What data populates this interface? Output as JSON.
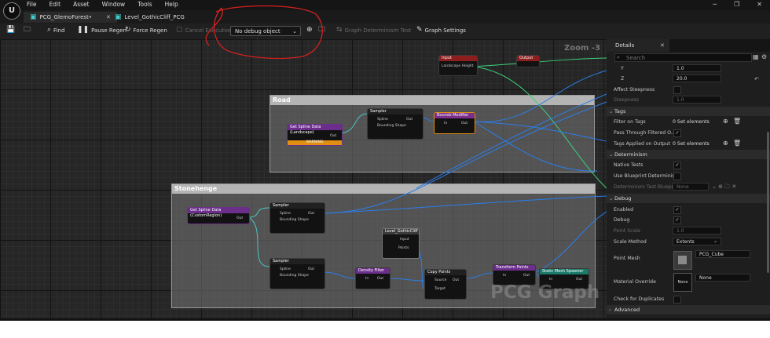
{
  "menu": {
    "logo": "U",
    "items": [
      "File",
      "Edit",
      "Asset",
      "Window",
      "Tools",
      "Help"
    ]
  },
  "tabs": [
    {
      "label": "PCG_GlemoForest•",
      "active": true
    },
    {
      "label": "Level_GothicCliff_PCG",
      "active": false
    }
  ],
  "toolbar": {
    "find": "Find",
    "pause_regen": "Pause Regen",
    "force_regen": "Force Regen",
    "cancel_execution": "Cancel Execution",
    "debug_selector": "No debug object selected",
    "graph_determinism": "Graph Determinism Test",
    "graph_settings": "Graph Settings"
  },
  "graph": {
    "zoom": "Zoom -3",
    "watermark": "PCG Graph",
    "comments": {
      "road": "Road",
      "stonehenge": "Stonehenge"
    },
    "nodes": {
      "input": {
        "title": "Input",
        "pin": "Landscape Height"
      },
      "output": {
        "title": "Output"
      },
      "road_spline": {
        "title": "Get Spline Data (Landscape)",
        "pin": "Out",
        "warning": "WARNING"
      },
      "road_sampler": {
        "title": "Sampler",
        "pin1": "Spline",
        "pin2": "Bounding Shape",
        "out": "Out"
      },
      "bounds_modifier": {
        "title": "Bounds Modifier",
        "pin": "In",
        "out": "Out"
      },
      "stone_spline": {
        "title": "Get Spline Data (CustomRegion)",
        "pin": "Out"
      },
      "stone_sampler1": {
        "title": "Sampler",
        "pin1": "Spline",
        "pin2": "Bounding Shape",
        "out": "Out"
      },
      "level_gothic": {
        "title": "Level_GothicCliff",
        "pin1": "Input",
        "pin2": "Points"
      },
      "stone_sampler2": {
        "title": "Sampler",
        "pin1": "Spline",
        "pin2": "Bounding Shape",
        "out": "Out"
      },
      "density_filter": {
        "title": "Density Filter",
        "pin": "In",
        "out": "Out"
      },
      "copy_points": {
        "title": "Copy Points",
        "pin1": "Source",
        "pin2": "Target",
        "out": "Out"
      },
      "transform_points": {
        "title": "Transform Points",
        "pin": "In",
        "out": "Out"
      },
      "static_mesh_spawner": {
        "title": "Static Mesh Spawner",
        "pin": "In",
        "out": "Out"
      }
    }
  },
  "details": {
    "tab": "Details",
    "search_placeholder": "Search",
    "y": {
      "label": "Y",
      "value": "1.0"
    },
    "z": {
      "label": "Z",
      "value": "20.0"
    },
    "affect_steepness": "Affect Steepness",
    "steepness": {
      "label": "Steepness",
      "value": "1.0"
    },
    "sections": {
      "tags": "Tags",
      "determinism": "Determinism",
      "debug": "Debug",
      "advanced": "Advanced"
    },
    "filter_on_tags": {
      "label": "Filter on Tags",
      "value": "0 Set elements"
    },
    "pass_through": "Pass Through Filtered O...",
    "tags_applied": {
      "label": "Tags Applied on Output",
      "value": "0 Set elements"
    },
    "native_tests": "Native Tests",
    "use_blueprint": "Use Blueprint Determinis...",
    "determinism_test_bp": {
      "label": "Determinism Test Bluepr...",
      "value": "None"
    },
    "enabled": "Enabled",
    "debug": "Debug",
    "point_scale": {
      "label": "Point Scale",
      "value": "1.0"
    },
    "scale_method": {
      "label": "Scale Method",
      "value": "Extents"
    },
    "point_mesh": {
      "label": "Point Mesh",
      "value": "PCG_Cube"
    },
    "material_override": {
      "label": "Material Override",
      "value": "None",
      "thumb": "None"
    },
    "check_duplicates": "Check for Duplicates"
  }
}
